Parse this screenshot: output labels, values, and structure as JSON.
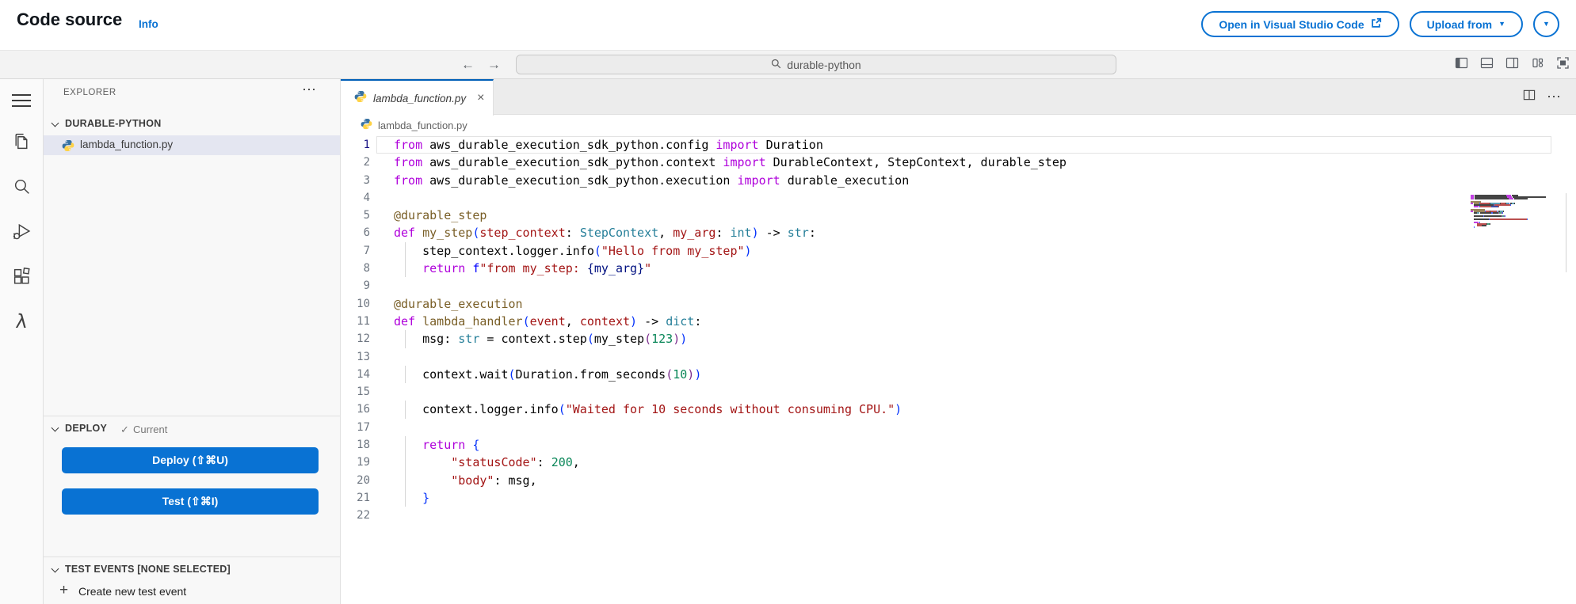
{
  "app": {
    "accent": "#0972d3",
    "tab_accent": "#005fb8",
    "selection_bg": "#e4e6f1"
  },
  "header": {
    "title": "Code source",
    "info": "Info",
    "open_vsc": "Open in Visual Studio Code",
    "upload": "Upload from"
  },
  "toolbar": {
    "search_value": "durable-python"
  },
  "icons": {
    "back": "←",
    "forward": "→",
    "ellipsis": "⋯",
    "close": "×",
    "caret": "▼",
    "check": "✓",
    "plus": "+"
  },
  "activity_bar": {
    "items": [
      "menu",
      "explorer",
      "search",
      "run-and-debug",
      "extensions",
      "aws-lambda"
    ]
  },
  "sidebar": {
    "explorer_title": "EXPLORER",
    "folder_name": "DURABLE-PYTHON",
    "file_name": "lambda_function.py",
    "deploy": {
      "title": "DEPLOY",
      "status": "Current",
      "deploy_button": "Deploy (⇧⌘U)",
      "test_button": "Test (⇧⌘I)"
    },
    "test_events": {
      "title": "TEST EVENTS [NONE SELECTED]",
      "create_label": "Create new test event"
    }
  },
  "editor": {
    "tab_name": "lambda_function.py",
    "breadcrumb": "lambda_function.py",
    "syntax_colors": {
      "kw": "#AF00DB",
      "dec": "#795E26",
      "fn": "#795E26",
      "par": "#A31515",
      "typ": "#267F99",
      "str": "#A31515",
      "num": "#098658",
      "br1": "#0431FA",
      "br2": "#7B2D8E",
      "fpre": "#0000FF",
      "var": "#001080",
      "pl": "#050505",
      "ln": "#6E7681",
      "ln_active": "#171184"
    },
    "code_lines": [
      {
        "n": 1,
        "cur": true,
        "g": 0,
        "segs": [
          [
            "kw",
            "from"
          ],
          [
            "pl",
            " aws_durable_execution_sdk_python.config "
          ],
          [
            "kw",
            "import"
          ],
          [
            "pl",
            " Duration"
          ]
        ]
      },
      {
        "n": 2,
        "g": 0,
        "segs": [
          [
            "kw",
            "from"
          ],
          [
            "pl",
            " aws_durable_execution_sdk_python.context "
          ],
          [
            "kw",
            "import"
          ],
          [
            "pl",
            " DurableContext, StepContext, durable_step"
          ]
        ]
      },
      {
        "n": 3,
        "g": 0,
        "segs": [
          [
            "kw",
            "from"
          ],
          [
            "pl",
            " aws_durable_execution_sdk_python.execution "
          ],
          [
            "kw",
            "import"
          ],
          [
            "pl",
            " durable_execution"
          ]
        ]
      },
      {
        "n": 4,
        "g": 0,
        "segs": []
      },
      {
        "n": 5,
        "g": 0,
        "segs": [
          [
            "dec",
            "@durable_step"
          ]
        ]
      },
      {
        "n": 6,
        "g": 0,
        "segs": [
          [
            "kw",
            "def"
          ],
          [
            "pl",
            " "
          ],
          [
            "fn",
            "my_step"
          ],
          [
            "br1",
            "("
          ],
          [
            "par",
            "step_context"
          ],
          [
            "pl",
            ": "
          ],
          [
            "typ",
            "StepContext"
          ],
          [
            "pl",
            ", "
          ],
          [
            "par",
            "my_arg"
          ],
          [
            "pl",
            ": "
          ],
          [
            "typ",
            "int"
          ],
          [
            "br1",
            ")"
          ],
          [
            "pl",
            " -> "
          ],
          [
            "typ",
            "str"
          ],
          [
            "pl",
            ":"
          ]
        ]
      },
      {
        "n": 7,
        "g": 1,
        "segs": [
          [
            "pl",
            "    step_context.logger.info"
          ],
          [
            "br1",
            "("
          ],
          [
            "str",
            "\"Hello from my_step\""
          ],
          [
            "br1",
            ")"
          ]
        ]
      },
      {
        "n": 8,
        "g": 1,
        "segs": [
          [
            "pl",
            "    "
          ],
          [
            "kw",
            "return"
          ],
          [
            "pl",
            " "
          ],
          [
            "fpre",
            "f"
          ],
          [
            "str",
            "\"from my_step: "
          ],
          [
            "var",
            "{my_arg}"
          ],
          [
            "str",
            "\""
          ]
        ]
      },
      {
        "n": 9,
        "g": 0,
        "segs": []
      },
      {
        "n": 10,
        "g": 0,
        "segs": [
          [
            "dec",
            "@durable_execution"
          ]
        ]
      },
      {
        "n": 11,
        "g": 0,
        "segs": [
          [
            "kw",
            "def"
          ],
          [
            "pl",
            " "
          ],
          [
            "fn",
            "lambda_handler"
          ],
          [
            "br1",
            "("
          ],
          [
            "par",
            "event"
          ],
          [
            "pl",
            ", "
          ],
          [
            "par",
            "context"
          ],
          [
            "br1",
            ")"
          ],
          [
            "pl",
            " -> "
          ],
          [
            "typ",
            "dict"
          ],
          [
            "pl",
            ":"
          ]
        ]
      },
      {
        "n": 12,
        "g": 1,
        "segs": [
          [
            "pl",
            "    msg: "
          ],
          [
            "typ",
            "str"
          ],
          [
            "pl",
            " = context.step"
          ],
          [
            "br1",
            "("
          ],
          [
            "pl",
            "my_step"
          ],
          [
            "br2",
            "("
          ],
          [
            "num",
            "123"
          ],
          [
            "br2",
            ")"
          ],
          [
            "br1",
            ")"
          ]
        ]
      },
      {
        "n": 13,
        "g": 1,
        "segs": []
      },
      {
        "n": 14,
        "g": 1,
        "segs": [
          [
            "pl",
            "    context.wait"
          ],
          [
            "br1",
            "("
          ],
          [
            "pl",
            "Duration.from_seconds"
          ],
          [
            "br2",
            "("
          ],
          [
            "num",
            "10"
          ],
          [
            "br2",
            ")"
          ],
          [
            "br1",
            ")"
          ]
        ]
      },
      {
        "n": 15,
        "g": 1,
        "segs": []
      },
      {
        "n": 16,
        "g": 1,
        "segs": [
          [
            "pl",
            "    context.logger.info"
          ],
          [
            "br1",
            "("
          ],
          [
            "str",
            "\"Waited for 10 seconds without consuming CPU.\""
          ],
          [
            "br1",
            ")"
          ]
        ]
      },
      {
        "n": 17,
        "g": 1,
        "segs": []
      },
      {
        "n": 18,
        "g": 1,
        "segs": [
          [
            "pl",
            "    "
          ],
          [
            "kw",
            "return"
          ],
          [
            "pl",
            " "
          ],
          [
            "br1",
            "{"
          ]
        ]
      },
      {
        "n": 19,
        "g": 1,
        "segs": [
          [
            "pl",
            "        "
          ],
          [
            "str",
            "\"statusCode\""
          ],
          [
            "pl",
            ": "
          ],
          [
            "num",
            "200"
          ],
          [
            "pl",
            ","
          ]
        ]
      },
      {
        "n": 20,
        "g": 1,
        "segs": [
          [
            "pl",
            "        "
          ],
          [
            "str",
            "\"body\""
          ],
          [
            "pl",
            ": msg,"
          ]
        ]
      },
      {
        "n": 21,
        "g": 1,
        "segs": [
          [
            "pl",
            "    "
          ],
          [
            "br1",
            "}"
          ]
        ]
      },
      {
        "n": 22,
        "g": 0,
        "segs": []
      }
    ]
  }
}
